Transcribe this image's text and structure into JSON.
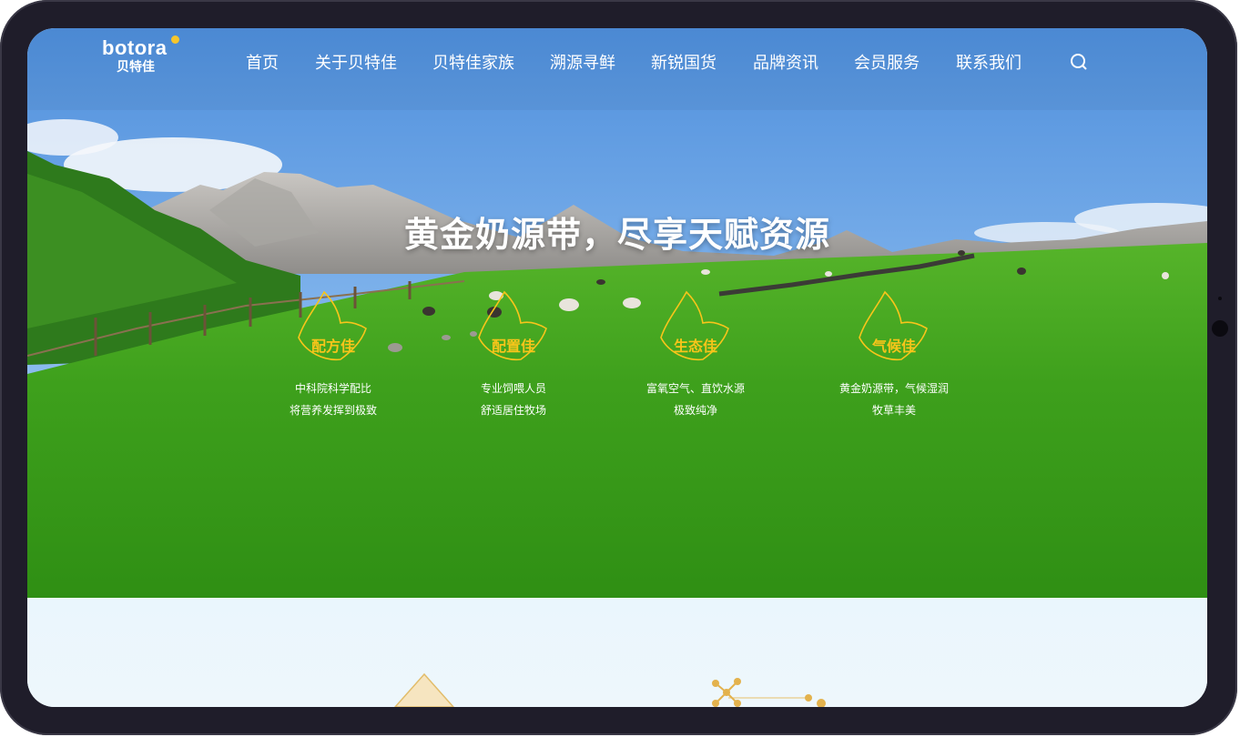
{
  "brand": {
    "name_en": "botora",
    "name_cn": "贝特佳"
  },
  "nav": {
    "items": [
      {
        "label": "首页"
      },
      {
        "label": "关于贝特佳"
      },
      {
        "label": "贝特佳家族"
      },
      {
        "label": "溯源寻鲜"
      },
      {
        "label": "新锐国货"
      },
      {
        "label": "品牌资讯"
      },
      {
        "label": "会员服务"
      },
      {
        "label": "联系我们"
      }
    ],
    "search_icon": "search-icon"
  },
  "hero": {
    "headline": "黄金奶源带，尽享天赋资源",
    "features": [
      {
        "title": "配方佳",
        "line1": "中科院科学配比",
        "line2": "将营养发挥到极致"
      },
      {
        "title": "配置佳",
        "line1": "专业饲喂人员",
        "line2": "舒适居住牧场"
      },
      {
        "title": "生态佳",
        "line1": "富氧空气、直饮水源",
        "line2": "极致纯净"
      },
      {
        "title": "气候佳",
        "line1": "黄金奶源带，气候湿润",
        "line2": "牧草丰美"
      }
    ]
  },
  "colors": {
    "accent": "#f8c51a",
    "frame": "#1f1d2a",
    "grass": "#3fa51e",
    "sky": "#6fa6e6"
  }
}
